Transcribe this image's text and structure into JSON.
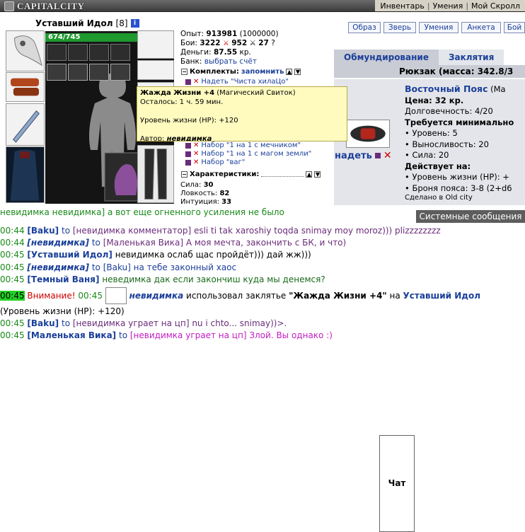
{
  "topbar": {
    "logo": "CAPITALCITY",
    "menu": [
      "Инвентарь",
      "Умения",
      "Мой Скролл"
    ]
  },
  "character": {
    "name": "Уставший Идол",
    "level": "[8]",
    "info_icon": "i",
    "hp": "674/745",
    "hp_fraction": 0.905
  },
  "stats": {
    "exp_label": "Опыт:",
    "exp_value": "913981",
    "exp_next": "(1000000)",
    "battles_label": "Бои:",
    "battles_win": "3222",
    "battles_loss": "952",
    "battles_draw": "27",
    "money_label": "Деньги:",
    "money_value": "87.55",
    "money_unit": "кр.",
    "bank_label": "Банк:",
    "bank_link": "выбрать счёт"
  },
  "sets": {
    "title": "Комплекты:",
    "remember": "запомнить",
    "items": [
      "Надеть \"Чиста хилаЦо\"",
      "Набор \"1 на 1 с мечником\"",
      "Набор \"1 на 1 с магом земли\"",
      "Набор \"ваг\""
    ]
  },
  "characteristics": {
    "title": "Характеристики:",
    "rows": [
      {
        "label": "Сила:",
        "value": "30"
      },
      {
        "label": "Ловкость:",
        "value": "82"
      },
      {
        "label": "Интуиция:",
        "value": "33"
      }
    ]
  },
  "buttons": [
    "Образ",
    "Зверь",
    "Умения",
    "Анкета",
    "Бой"
  ],
  "panel": {
    "tabs": [
      "Обмундирование",
      "Заклятия"
    ],
    "backpack": "Рюкзак (масса: 342.8/3",
    "wear": "надеть"
  },
  "item": {
    "name": "Восточный Пояс",
    "name_suffix": "(Ма",
    "price": "Цена: 32 кр.",
    "durability": "Долговечность: 4/20",
    "requires": "Требуется минимально",
    "req": [
      "• Уровень: 5",
      "• Выносливость: 20",
      "• Сила: 20"
    ],
    "acts": "Действует на:",
    "effects": [
      "• Уровень жизни (HP): +",
      "• Броня пояса: 3-8 (2+d6"
    ],
    "made": "Сделано в Old city"
  },
  "tooltip": {
    "title": "Жажда Жизни +4",
    "kind": "(Магический Свиток)",
    "remaining": "Осталось: 1 ч. 59 мин.",
    "effect": "Уровень жизни (HP): +120",
    "author_label": "Автор:",
    "author": "невидимка"
  },
  "chat_tabs": {
    "cut_line": "невидимка невидимка] а вот еще огненного усиления не было",
    "chat": "Чат",
    "system": "Системные сообщения"
  },
  "chat": {
    "l1": {
      "time": "00:44",
      "nick": "[Baku]",
      "to": "to",
      "target": "[невидимка комментатор]",
      "text": " esli ti tak xaroshiy toqda snimay moy moroz))) plizzzzzzzz"
    },
    "l2": {
      "time": "00:44",
      "nick": "[невидимка]",
      "to": "to",
      "target": "[Маленькая Вика]",
      "text": " А моя мечта, закончить с БК, и что)"
    },
    "l3": {
      "time": "00:45",
      "nick": "[Уставший Идол]",
      "text": " невидимка ослаб щас пройдёт))) дай жж)))"
    },
    "l4": {
      "time": "00:45",
      "nick": "[невидимка]",
      "to": "to",
      "target": "[Baku]",
      "text": " на тебе законный хаос"
    },
    "l5": {
      "time": "00:45",
      "nick": "[Темный Ваня]",
      "text": " невeдимка дак если закончиш куда мы денемся?"
    },
    "l6": {
      "time": "00:45",
      "alarm": "Внимание!",
      "time2": "00:45",
      "caster": "невидимка",
      "used": " использовал заклятье ",
      "spell": "\"Жажда Жизни +4\"",
      "on": " на ",
      "target": "Уставший Идол"
    },
    "l7": {
      "text": "(Уровень жизни (HP): +120)"
    },
    "l8": {
      "time": "00:45",
      "nick": "[Baku]",
      "to": "to",
      "target": "[невидимка уграет на цп]",
      "text": " nu i chto... snimay))>."
    },
    "l9": {
      "time": "00:45",
      "nick": "[Маленькая Вика]",
      "to": "to",
      "target": "[невидимка уграет на цп]",
      "text": " Злой. Вы однако :)"
    }
  }
}
